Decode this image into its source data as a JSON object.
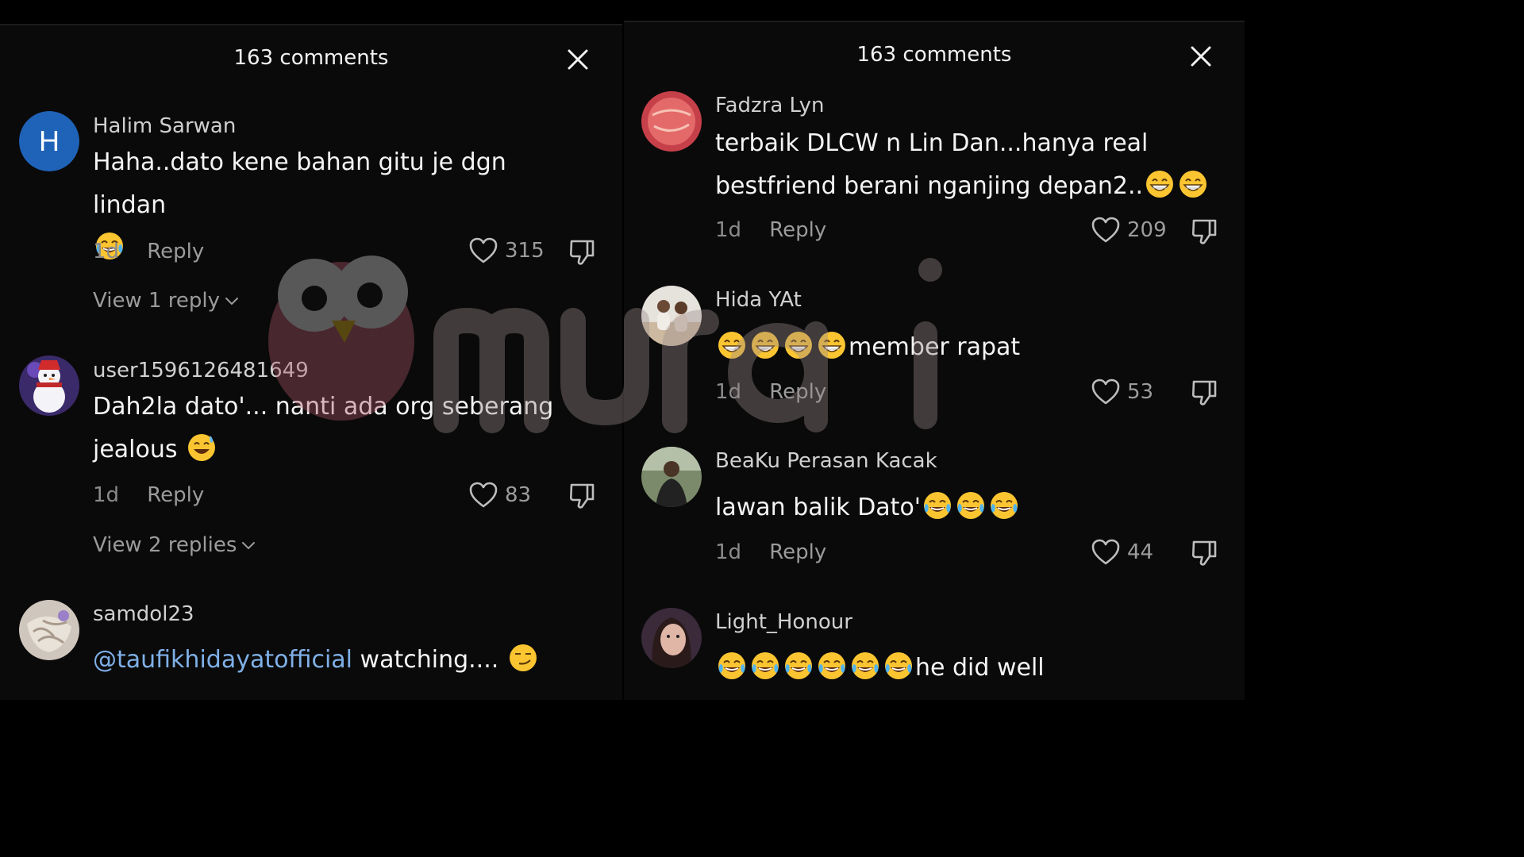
{
  "left_panel": {
    "title": "163 comments",
    "comments": [
      {
        "avatar_letter": "H",
        "username": "Halim Sarwan",
        "text": "Haha..dato kene bahan gitu je dgn lindan",
        "emojis": [
          "face-with-tears-of-joy"
        ],
        "age": "1d",
        "reply_label": "Reply",
        "likes": "315",
        "view_replies": "View 1 reply"
      },
      {
        "username": "user1596126481649",
        "text_line1": "Dah2la dato'... nanti ada org seberang",
        "text_line2": "jealous",
        "emojis": [
          "grinning-face-with-sweat"
        ],
        "age": "1d",
        "reply_label": "Reply",
        "likes": "83",
        "view_replies": "View 2 replies"
      },
      {
        "username": "samdol23",
        "mention": "@taufikhidayatofficial",
        "text": " watching....",
        "emojis": [
          "smirking-face"
        ]
      }
    ]
  },
  "right_panel": {
    "title": "163 comments",
    "comments": [
      {
        "username": "Fadzra Lyn",
        "text_line1": "terbaik DLCW n Lin Dan...hanya real",
        "text_line2": "bestfriend berani nganjing depan2..",
        "emojis": [
          "beaming-face",
          "beaming-face"
        ],
        "age": "1d",
        "reply_label": "Reply",
        "likes": "209"
      },
      {
        "username": "Hida YAt",
        "text": "member rapat",
        "emojis": [
          "beaming-face",
          "beaming-face",
          "beaming-face",
          "beaming-face"
        ],
        "age": "1d",
        "reply_label": "Reply",
        "likes": "53"
      },
      {
        "username": "BeaKu Perasan Kacak",
        "text": "lawan balik Dato'",
        "emojis": [
          "face-with-tears-of-joy",
          "face-with-tears-of-joy",
          "face-with-tears-of-joy"
        ],
        "age": "1d",
        "reply_label": "Reply",
        "likes": "44"
      },
      {
        "username": "Light_Honour",
        "text": "he did well",
        "emojis": [
          "face-with-tears-of-joy",
          "face-with-tears-of-joy",
          "face-with-tears-of-joy",
          "face-with-tears-of-joy",
          "face-with-tears-of-joy",
          "face-with-tears-of-joy"
        ]
      }
    ]
  },
  "watermark": {
    "brand": "murai"
  },
  "colors": {
    "background": "#0a0a0a",
    "mention": "#7fb0e8",
    "avatar_h": "#1f63b8",
    "muted": "#8a8a8a"
  }
}
